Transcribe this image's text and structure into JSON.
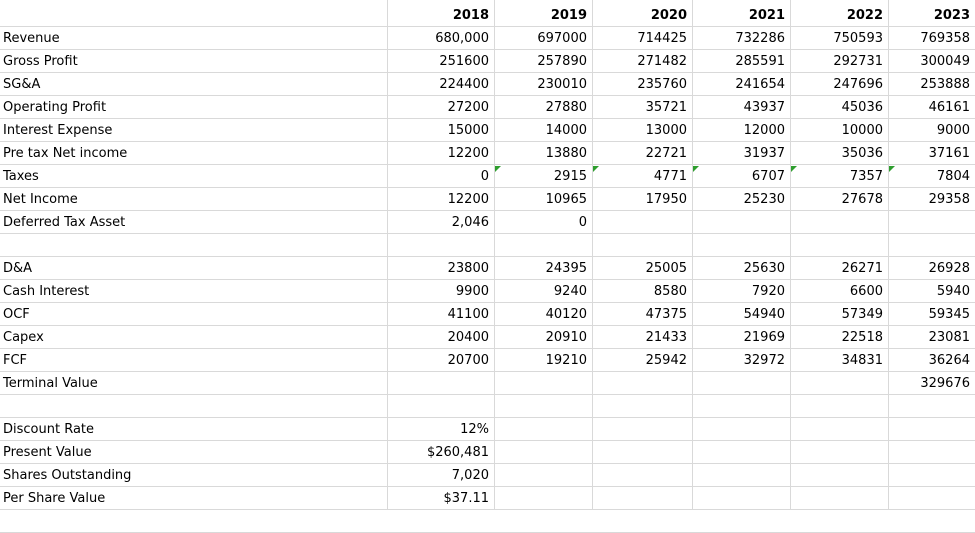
{
  "sheet": {
    "years": [
      "2018",
      "2019",
      "2020",
      "2021",
      "2022",
      "2023"
    ],
    "income_rows": [
      {
        "label": "Revenue",
        "values": [
          "680,000",
          "697000",
          "714425",
          "732286",
          "750593",
          "769358"
        ]
      },
      {
        "label": "Gross Profit",
        "values": [
          "251600",
          "257890",
          "271482",
          "285591",
          "292731",
          "300049"
        ]
      },
      {
        "label": "SG&A",
        "values": [
          "224400",
          "230010",
          "235760",
          "241654",
          "247696",
          "253888"
        ]
      },
      {
        "label": "Operating Profit",
        "values": [
          "27200",
          "27880",
          "35721",
          "43937",
          "45036",
          "46161"
        ]
      },
      {
        "label": "Interest Expense",
        "values": [
          "15000",
          "14000",
          "13000",
          "12000",
          "10000",
          "9000"
        ]
      },
      {
        "label": "Pre tax Net income",
        "values": [
          "12200",
          "13880",
          "22721",
          "31937",
          "35036",
          "37161"
        ]
      },
      {
        "label": "Taxes",
        "values": [
          "0",
          "2915",
          "4771",
          "6707",
          "7357",
          "7804"
        ]
      },
      {
        "label": "Net Income",
        "values": [
          "12200",
          "10965",
          "17950",
          "25230",
          "27678",
          "29358"
        ]
      },
      {
        "label": "Deferred Tax Asset",
        "values": [
          "2,046",
          "0",
          "",
          "",
          "",
          ""
        ]
      }
    ],
    "cash_rows": [
      {
        "label": "D&A",
        "values": [
          "23800",
          "24395",
          "25005",
          "25630",
          "26271",
          "26928"
        ]
      },
      {
        "label": "Cash Interest",
        "values": [
          "9900",
          "9240",
          "8580",
          "7920",
          "6600",
          "5940"
        ]
      },
      {
        "label": "OCF",
        "values": [
          "41100",
          "40120",
          "47375",
          "54940",
          "57349",
          "59345"
        ]
      },
      {
        "label": "Capex",
        "values": [
          "20400",
          "20910",
          "21433",
          "21969",
          "22518",
          "23081"
        ]
      },
      {
        "label": "FCF",
        "values": [
          "20700",
          "19210",
          "25942",
          "32972",
          "34831",
          "36264"
        ]
      },
      {
        "label": "Terminal Value",
        "values": [
          "",
          "",
          "",
          "",
          "",
          "329676"
        ]
      }
    ],
    "valuation_rows": [
      {
        "label": "Discount Rate",
        "value": "12%"
      },
      {
        "label": "Present Value",
        "value": "$260,481"
      },
      {
        "label": "Shares Outstanding",
        "value": "7,020"
      },
      {
        "label": "Per Share Value",
        "value": "$37.11"
      }
    ],
    "error_flag_color": "#2e9e2e"
  }
}
